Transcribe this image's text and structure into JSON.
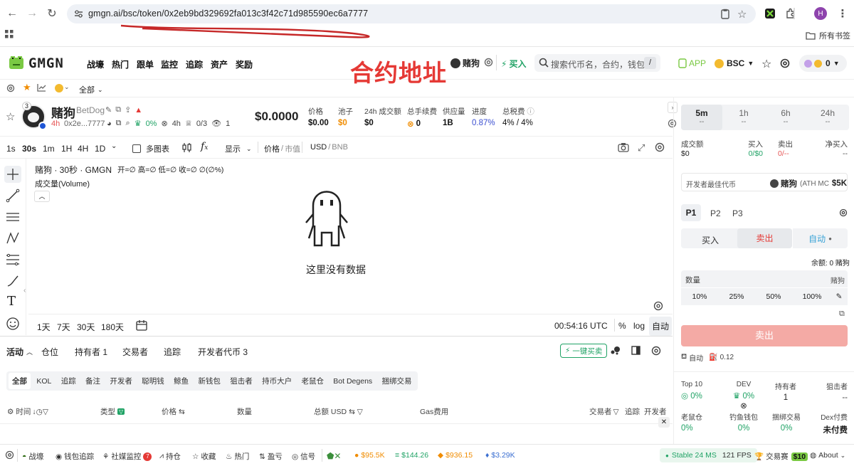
{
  "browser": {
    "url": "gmgn.ai/bsc/token/0x2eb9bd329692fa013c3f42c71d985590ec6a7777",
    "bookmarks_label": "所有书签",
    "profile_initial": "H"
  },
  "nav": {
    "logo": "GMGN",
    "items": [
      "战壕",
      "热门",
      "跟单",
      "监控",
      "追踪",
      "资产",
      "奖励"
    ],
    "overlay_note": "合约地址",
    "token_name": "赌狗",
    "buy_label": "买入",
    "search_placeholder": "搜索代币名，合约，钱包",
    "search_shortcut": "/",
    "app_label": "APP",
    "chain_label": "BSC",
    "balance": "0"
  },
  "subbar": {
    "filter_label": "全部"
  },
  "token": {
    "name": "赌狗",
    "symbol": "BetDog",
    "age": "4h",
    "short_address": "0x2e...7777",
    "holder_badge": "3",
    "pct_stat": "0%",
    "time_stat": "4h",
    "ratio_stat": "0/3",
    "view_count": "1",
    "price_big": "$0.0000",
    "stats": [
      {
        "label": "价格",
        "value": "$0.00"
      },
      {
        "label": "池子",
        "value": "$0"
      },
      {
        "label": "24h 成交额",
        "value": "$0"
      },
      {
        "label": "总手续费",
        "value": "0"
      },
      {
        "label": "供应量",
        "value": "1B"
      },
      {
        "label": "进度",
        "value": "0.87%"
      },
      {
        "label": "总税费",
        "value": "4% / 4%"
      }
    ]
  },
  "chart": {
    "intervals": [
      "1s",
      "30s",
      "1m",
      "1H",
      "4H",
      "1D"
    ],
    "active_interval": "30s",
    "multi_chart": "多图表",
    "display": "显示",
    "price_toggle": "价格",
    "mcap_toggle": "市值",
    "currency_a": "USD",
    "currency_b": "BNB",
    "legend_title": "赌狗 · 30秒 · GMGN",
    "legend_ohlc": "开=∅ 高=∅ 低=∅ 收=∅ ∅(∅%)",
    "volume_label": "成交量(Volume)",
    "empty_text": "这里没有数据",
    "ranges": [
      "1天",
      "7天",
      "30天",
      "180天"
    ],
    "clock": "00:54:16 UTC",
    "pct": "%",
    "log": "log",
    "auto": "自动"
  },
  "bottom": {
    "tabs": [
      "活动",
      "仓位",
      "持有者 1",
      "交易者",
      "追踪",
      "开发者代币 3"
    ],
    "quick_buy": "一键买卖",
    "filters": [
      "全部",
      "KOL",
      "追踪",
      "备注",
      "开发者",
      "聪明钱",
      "鲸鱼",
      "新钱包",
      "狙击者",
      "持币大户",
      "老鼠仓",
      "Bot Degens",
      "捆绑交易"
    ],
    "columns": {
      "time": "时间",
      "type": "类型",
      "price": "价格",
      "qty": "数量",
      "total": "总额 USD",
      "gas": "Gas费用",
      "trader": "交易者",
      "track": "追踪",
      "dev": "开发者"
    }
  },
  "right": {
    "timeframes": [
      "5m",
      "1h",
      "6h",
      "24h"
    ],
    "timeframe_values": [
      "--",
      "--",
      "--",
      "--"
    ],
    "vol_labels": [
      "成交额",
      "买入",
      "卖出",
      "净买入"
    ],
    "vol_values": [
      "$0",
      "0/$0",
      "0/--",
      "--"
    ],
    "dev_best": "开发者最佳代币",
    "dev_best_name": "赌狗",
    "dev_best_ath": "(ATH MC",
    "dev_best_mc": "$5K",
    "presets": [
      "P1",
      "P2",
      "P3"
    ],
    "trade_tabs": [
      "买入",
      "卖出",
      "自动"
    ],
    "balance": "余额: 0 赌狗",
    "qty_label": "数量",
    "qty_unit": "赌狗",
    "pcts": [
      "10%",
      "25%",
      "50%",
      "100%"
    ],
    "sell_button": "卖出",
    "auto_label": "自动",
    "slippage": "0.12",
    "metrics1_labels": [
      "Top 10",
      "DEV",
      "持有者",
      "狙击者"
    ],
    "metrics1_values": [
      "0%",
      "0%",
      "1",
      "--"
    ],
    "metrics2_labels": [
      "老鼠仓",
      "钓鱼钱包",
      "捆绑交易",
      "Dex付费"
    ],
    "metrics2_values": [
      "0%",
      "0%",
      "0%",
      "未付费"
    ]
  },
  "footer": {
    "items": [
      "战壕",
      "钱包追踪",
      "社媒监控",
      "持仓",
      "收藏",
      "热门",
      "盈亏",
      "信号"
    ],
    "social_badge": "7",
    "tickers": [
      "$95.5K",
      "$144.26",
      "$936.15",
      "$3.29K"
    ],
    "status": "Stable 24 MS",
    "fps": "121 FPS",
    "trade_contest": "交易赛",
    "contest_badge": "$10",
    "about": "About"
  }
}
